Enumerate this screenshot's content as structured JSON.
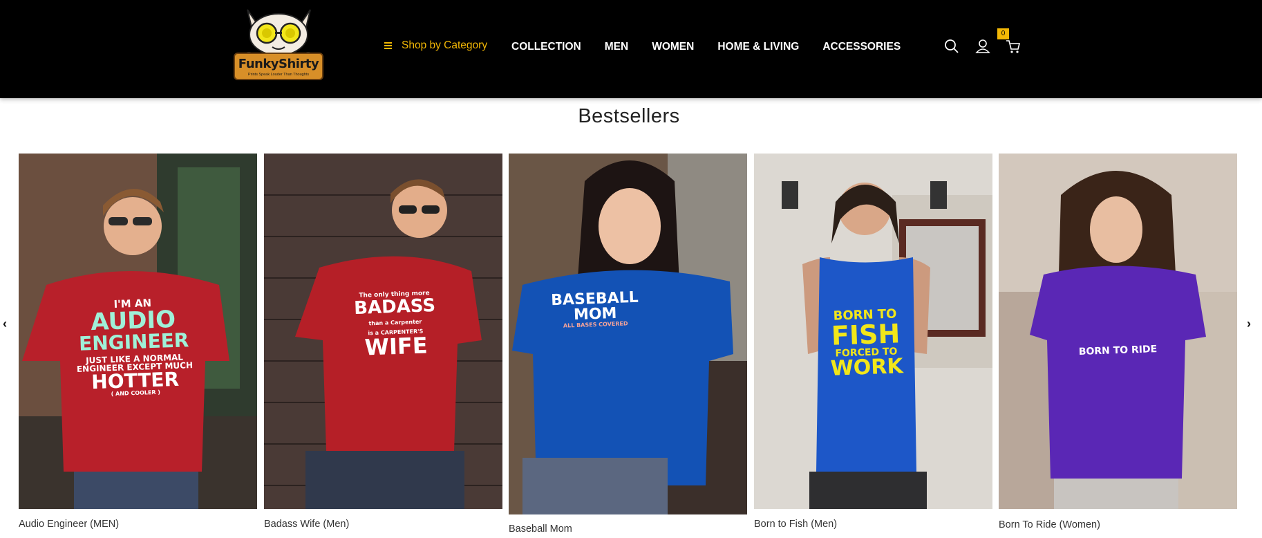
{
  "header": {
    "logo": {
      "name": "FunkyShirty",
      "tagline": "Prints Speak Louder Than Thoughts"
    },
    "shop_by_category": "Shop by Category",
    "nav": [
      "COLLECTION",
      "MEN",
      "WOMEN",
      "HOME & LIVING",
      "ACCESSORIES"
    ],
    "cart_count": "0",
    "icons": [
      "search-icon",
      "user-icon",
      "cart-icon"
    ]
  },
  "section": {
    "title": "Bestsellers"
  },
  "carousel": {
    "prev_icon": "‹",
    "next_icon": "›",
    "products": [
      {
        "name": "Audio Engineer (MEN)",
        "shirt_color": "#b8202a",
        "print": [
          "I'M AN",
          "AUDIO",
          "ENGINEER",
          "JUST LIKE A NORMAL",
          "ENGINEER EXCEPT MUCH",
          "HOTTER",
          "( AND COOLER )"
        ]
      },
      {
        "name": "Badass Wife (Men)",
        "shirt_color": "#b51f27",
        "print": [
          "The only thing more",
          "BADASS",
          "than a Carpenter",
          "is a CARPENTER'S",
          "WIFE"
        ]
      },
      {
        "name": "Baseball Mom",
        "shirt_color": "#1352b5",
        "print": [
          "BASEBALL",
          "MOM",
          "ALL BASES COVERED"
        ]
      },
      {
        "name": "Born to Fish (Men)",
        "shirt_color": "#1d57c8",
        "print": [
          "BORN TO",
          "FISH",
          "FORCED TO",
          "WORK"
        ]
      },
      {
        "name": "Born To Ride (Women)",
        "shirt_color": "#5a27b5",
        "print": [
          "BORN TO RIDE"
        ]
      }
    ]
  },
  "colors": {
    "header_bg": "#000000",
    "accent": "#f2b705",
    "nav_text": "#ffffff"
  }
}
